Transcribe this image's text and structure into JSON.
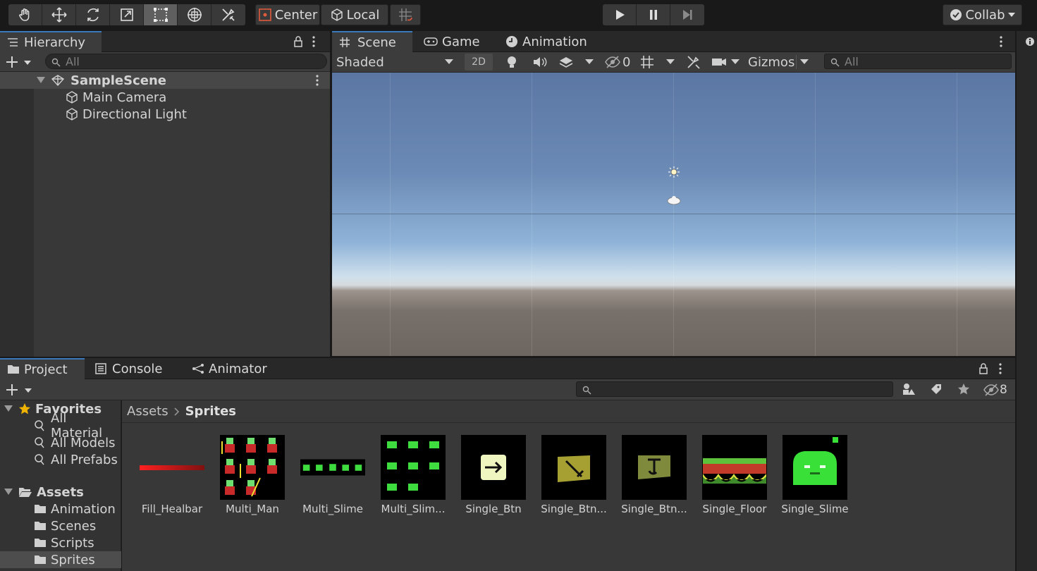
{
  "toolbar": {
    "tools": [
      "hand-tool",
      "move-tool",
      "rotate-tool",
      "scale-tool",
      "rect-tool",
      "transform-tool",
      "custom-tool"
    ],
    "active_tool": "rect-tool",
    "pivot_label": "Center",
    "space_label": "Local",
    "collab_label": "Collab"
  },
  "hierarchy": {
    "tab_label": "Hierarchy",
    "search_placeholder": "All",
    "scene_name": "SampleScene",
    "items": [
      "Main Camera",
      "Directional Light"
    ]
  },
  "scene": {
    "tabs": [
      "Scene",
      "Game",
      "Animation"
    ],
    "shading_mode": "Shaded",
    "mode_2d_label": "2D",
    "hidden_count": "0",
    "gizmos_label": "Gizmos",
    "search_placeholder": "All"
  },
  "project": {
    "tabs": [
      "Project",
      "Console",
      "Animator"
    ],
    "hidden_count": "8",
    "favorites_label": "Favorites",
    "favorites": [
      "All Material",
      "All Models",
      "All Prefabs"
    ],
    "assets_label": "Assets",
    "folders": [
      "Animation",
      "Scenes",
      "Scripts",
      "Sprites"
    ],
    "selected_folder": "Sprites",
    "breadcrumb": [
      "Assets",
      "Sprites"
    ],
    "sprites": [
      "Fill_Healbar",
      "Multi_Man",
      "Multi_Slime",
      "Multi_Slim...",
      "Single_Btn",
      "Single_Btn...",
      "Single_Btn...",
      "Single_Floor",
      "Single_Slime"
    ]
  },
  "colors": {
    "accent": "#3a79bb",
    "panel": "#383838",
    "toolbar": "#191919"
  }
}
